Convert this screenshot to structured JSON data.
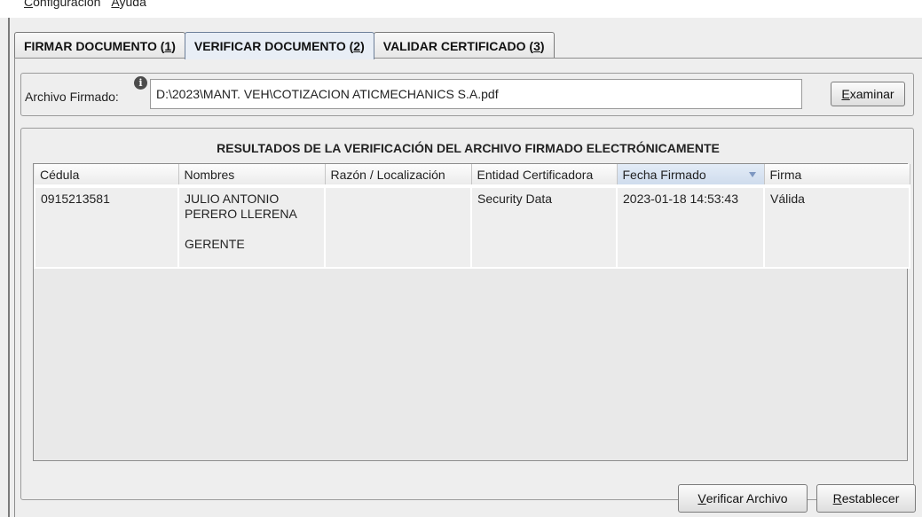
{
  "menu": {
    "items": [
      {
        "pre": "",
        "ul": "C",
        "post": "onfiguración"
      },
      {
        "pre": "",
        "ul": "A",
        "post": "yuda"
      }
    ]
  },
  "tabs": [
    {
      "label": "FIRMAR DOCUMENTO (",
      "ul": "1",
      "post": ")"
    },
    {
      "label": "VERIFICAR DOCUMENTO (",
      "ul": "2",
      "post": ")"
    },
    {
      "label": "VALIDAR CERTIFICADO (",
      "ul": "3",
      "post": ")"
    }
  ],
  "active_tab": 1,
  "file": {
    "label": "Archivo Firmado:",
    "value": "D:\\2023\\MANT. VEH\\COTIZACION ATICMECHANICS S.A.pdf",
    "examinar_ul": "E",
    "examinar_post": "xaminar"
  },
  "results": {
    "title": "RESULTADOS DE LA VERIFICACIÓN DEL ARCHIVO FIRMADO ELECTRÓNICAMENTE",
    "columns": [
      "Cédula",
      "Nombres",
      "Razón / Localización",
      "Entidad Certificadora",
      "Fecha Firmado",
      "Firma"
    ],
    "sorted_column": 4,
    "rows": [
      {
        "cedula": "0915213581",
        "nombres_line1": "JULIO ANTONIO",
        "nombres_line2": "PERERO LLERENA",
        "nombres_line3": "GERENTE",
        "razon": "",
        "entidad": "Security Data",
        "fecha": "2023-01-18 14:53:43",
        "firma": "Válida"
      }
    ]
  },
  "buttons": {
    "verificar_ul": "V",
    "verificar_post": "erificar Archivo",
    "restablecer_ul": "R",
    "restablecer_post": "establecer"
  }
}
